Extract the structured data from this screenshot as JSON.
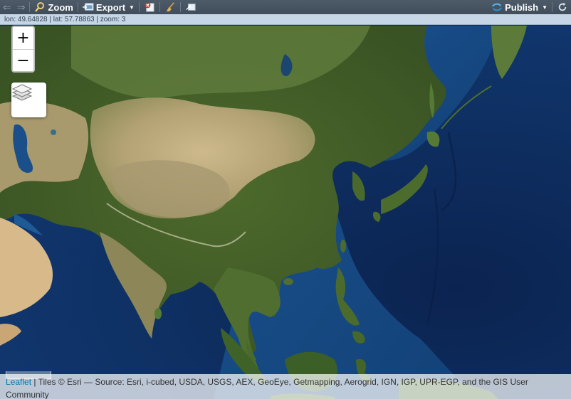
{
  "toolbar": {
    "zoom_label": "Zoom",
    "export_label": "Export",
    "publish_label": "Publish",
    "icons": [
      "back-arrow-icon",
      "forward-arrow-icon",
      "zoom-magnifier-icon",
      "export-icon",
      "remove-plot-icon",
      "clear-broom-icon",
      "popout-icon",
      "publish-icon",
      "refresh-icon"
    ]
  },
  "coords": {
    "text": "lon: 49.64828 | lat: 57.78863 | zoom: 3"
  },
  "map": {
    "zoom_in": "+",
    "zoom_out": "−",
    "attribution": {
      "link": "Leaflet",
      "text": " | Tiles © Esri — Source: Esri, i-cubed, USDA, USGS, AEX, GeoEye, Getmapping, Aerogrid, IGN, IGP, UPR-EGP, and the GIS User Community"
    }
  },
  "colors": {
    "ocean": "#0f3266",
    "land_desert": "#b9a77c",
    "land_forest": "#4f6b32",
    "toolbar": "#465260",
    "accent": "#0078a8"
  }
}
